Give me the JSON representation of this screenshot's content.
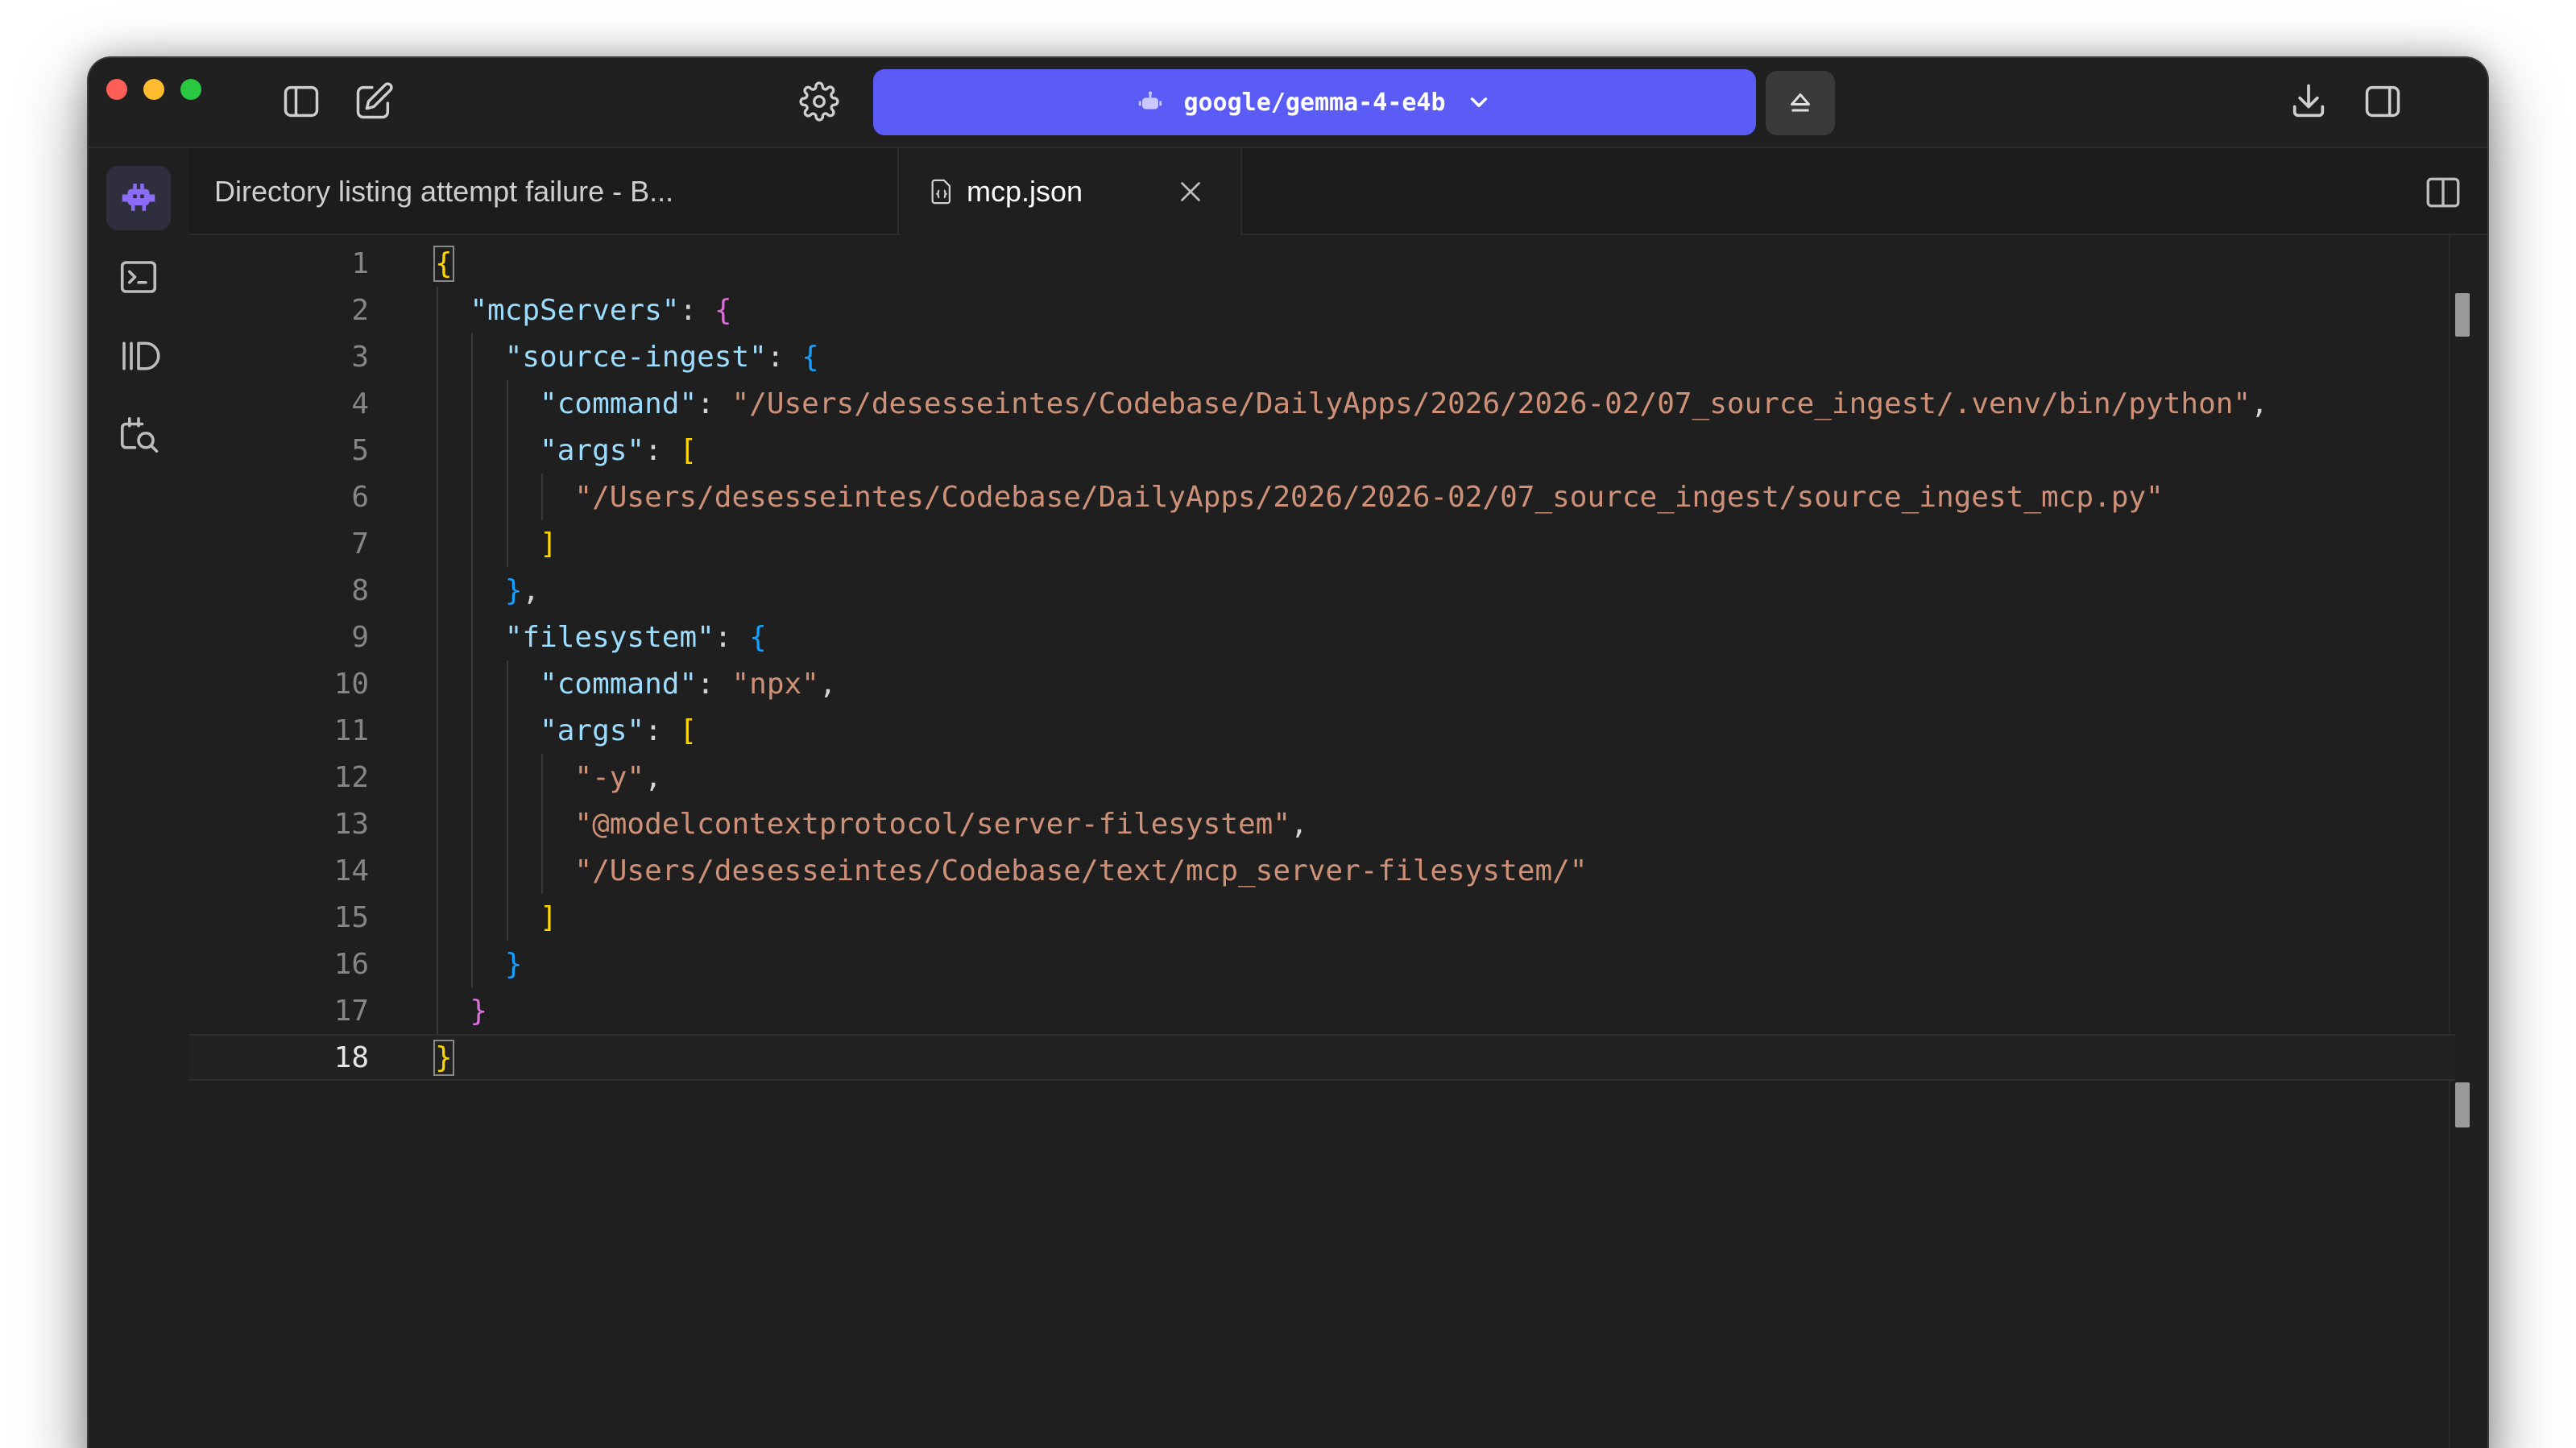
{
  "titlebar": {
    "model_name": "google/gemma-4-e4b",
    "icons": [
      "sidebar-toggle-icon",
      "new-chat-icon",
      "gear-icon",
      "chevron-down-icon",
      "eject-icon",
      "download-icon",
      "right-panel-icon"
    ]
  },
  "activity_bar": {
    "items": [
      "robot-icon",
      "terminal-icon",
      "library-icon",
      "search-document-icon"
    ]
  },
  "tabs": [
    {
      "label": "Directory listing attempt failure - B...",
      "active": false
    },
    {
      "label": "mcp.json",
      "active": true
    }
  ],
  "editor": {
    "current_line": "18",
    "line_numbers": [
      "1",
      "2",
      "3",
      "4",
      "5",
      "6",
      "7",
      "8",
      "9",
      "10",
      "11",
      "12",
      "13",
      "14",
      "15",
      "16",
      "17",
      "18"
    ],
    "lines": [
      [
        [
          "b1",
          "{"
        ]
      ],
      [
        [
          "p",
          "  "
        ],
        [
          "k",
          "\"mcpServers\""
        ],
        [
          "p",
          ": "
        ],
        [
          "b2",
          "{"
        ]
      ],
      [
        [
          "p",
          "    "
        ],
        [
          "k",
          "\"source-ingest\""
        ],
        [
          "p",
          ": "
        ],
        [
          "b3",
          "{"
        ]
      ],
      [
        [
          "p",
          "      "
        ],
        [
          "k",
          "\"command\""
        ],
        [
          "p",
          ": "
        ],
        [
          "s",
          "\"/Users/desesseintes/Codebase/DailyApps/2026/2026-02/07_source_ingest/.venv/bin/python\""
        ],
        [
          "p",
          ","
        ]
      ],
      [
        [
          "p",
          "      "
        ],
        [
          "k",
          "\"args\""
        ],
        [
          "p",
          ": "
        ],
        [
          "b1",
          "["
        ]
      ],
      [
        [
          "p",
          "        "
        ],
        [
          "s",
          "\"/Users/desesseintes/Codebase/DailyApps/2026/2026-02/07_source_ingest/source_ingest_mcp.py\""
        ]
      ],
      [
        [
          "p",
          "      "
        ],
        [
          "b1",
          "]"
        ]
      ],
      [
        [
          "p",
          "    "
        ],
        [
          "b3",
          "}"
        ],
        [
          "p",
          ","
        ]
      ],
      [
        [
          "p",
          "    "
        ],
        [
          "k",
          "\"filesystem\""
        ],
        [
          "p",
          ": "
        ],
        [
          "b3",
          "{"
        ]
      ],
      [
        [
          "p",
          "      "
        ],
        [
          "k",
          "\"command\""
        ],
        [
          "p",
          ": "
        ],
        [
          "s",
          "\"npx\""
        ],
        [
          "p",
          ","
        ]
      ],
      [
        [
          "p",
          "      "
        ],
        [
          "k",
          "\"args\""
        ],
        [
          "p",
          ": "
        ],
        [
          "b1",
          "["
        ]
      ],
      [
        [
          "p",
          "        "
        ],
        [
          "s",
          "\"-y\""
        ],
        [
          "p",
          ","
        ]
      ],
      [
        [
          "p",
          "        "
        ],
        [
          "s",
          "\"@modelcontextprotocol/server-filesystem\""
        ],
        [
          "p",
          ","
        ]
      ],
      [
        [
          "p",
          "        "
        ],
        [
          "s",
          "\"/Users/desesseintes/Codebase/text/mcp_server-filesystem/\""
        ]
      ],
      [
        [
          "p",
          "      "
        ],
        [
          "b1",
          "]"
        ]
      ],
      [
        [
          "p",
          "    "
        ],
        [
          "b3",
          "}"
        ]
      ],
      [
        [
          "p",
          "  "
        ],
        [
          "b2",
          "}"
        ]
      ],
      [
        [
          "b1",
          "}"
        ]
      ]
    ],
    "token_colors": {
      "k": "#9cdcfe",
      "s": "#ce9178",
      "p": "#d4d4d4",
      "b1": "#ffd700",
      "b2": "#da70d6",
      "b3": "#179fff"
    }
  },
  "colors": {
    "accent": "#5b5bf5",
    "window_bg": "#1f1f1f"
  }
}
